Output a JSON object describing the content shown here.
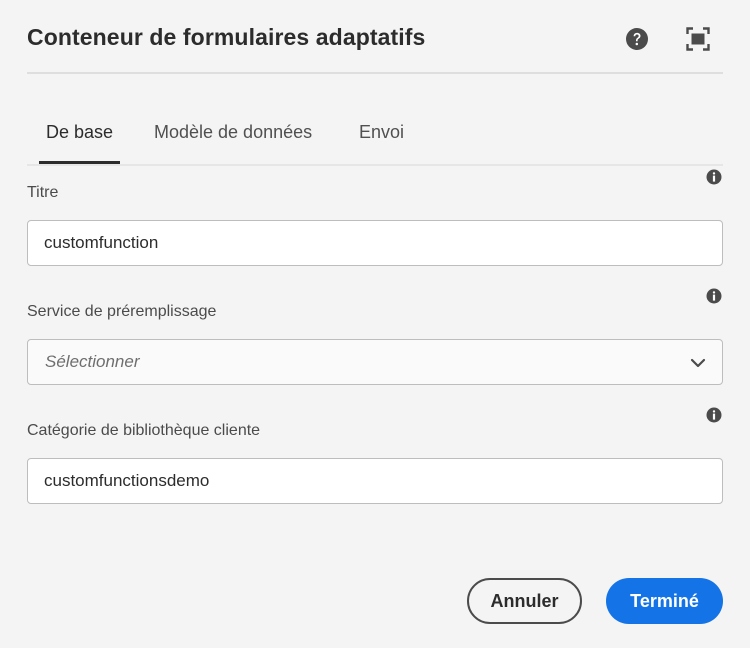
{
  "dialog": {
    "title": "Conteneur de formulaires adaptatifs",
    "icons": {
      "help": "help-icon",
      "fullscreen": "fullscreen-icon",
      "info": "info-icon",
      "chevron": "chevron-down-icon"
    }
  },
  "tabs": [
    {
      "label": "De base",
      "active": true
    },
    {
      "label": "Modèle de données",
      "active": false
    },
    {
      "label": "Envoi",
      "active": false
    }
  ],
  "fields": {
    "title": {
      "label": "Titre",
      "value": "customfunction"
    },
    "prefill_service": {
      "label": "Service de préremplissage",
      "selected": "Sélectionner"
    },
    "client_library_category": {
      "label": "Catégorie de bibliothèque cliente",
      "value": "customfunctionsdemo"
    }
  },
  "footer": {
    "cancel_label": "Annuler",
    "done_label": "Terminé"
  },
  "colors": {
    "background": "#f4f4f4",
    "primary": "#1473e6",
    "text": "#2c2c2c",
    "icon": "#4b4b4b"
  }
}
